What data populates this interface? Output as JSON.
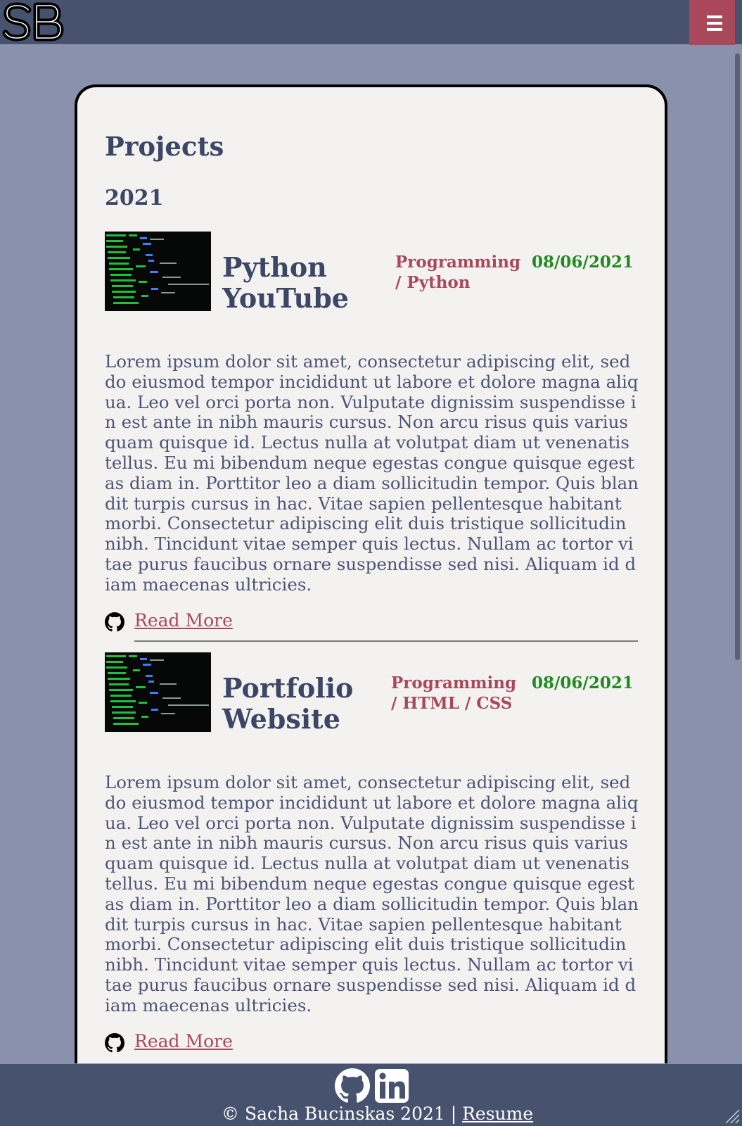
{
  "header": {
    "logo_text": "SB",
    "menu_icon": "hamburger-menu-icon"
  },
  "main": {
    "title": "Projects",
    "year": "2021",
    "projects": [
      {
        "title_line1": "Python",
        "title_line2": "YouTube",
        "category_line1": "Programming",
        "category_line2": "/ Python",
        "date": "08/06/2021",
        "description": "Lorem ipsum dolor sit amet, consectetur adipiscing elit, sed do eiusmod tempor incididunt ut labore et dolore magna aliqua. Leo vel orci porta non. Vulputate dignissim suspendisse in est ante in nibh mauris cursus. Non arcu risus quis varius quam quisque id. Lectus nulla at volutpat diam ut venenatis tellus. Eu mi bibendum neque egestas congue quisque egestas diam in. Porttitor leo a diam sollicitudin tempor. Quis blandit turpis cursus in hac. Vitae sapien pellentesque habitant morbi. Consectetur adipiscing elit duis tristique sollicitudin nibh. Tincidunt vitae semper quis lectus. Nullam ac tortor vitae purus faucibus ornare suspendisse sed nisi. Aliquam id diam maecenas ultricies.",
        "read_more": "Read More",
        "link_icon": "github-icon"
      },
      {
        "title_line1": "Portfolio",
        "title_line2": "Website",
        "category_line1": "Programming",
        "category_line2": "/ HTML / CSS",
        "date": "08/06/2021",
        "description": "Lorem ipsum dolor sit amet, consectetur adipiscing elit, sed do eiusmod tempor incididunt ut labore et dolore magna aliqua. Leo vel orci porta non. Vulputate dignissim suspendisse in est ante in nibh mauris cursus. Non arcu risus quis varius quam quisque id. Lectus nulla at volutpat diam ut venenatis tellus. Eu mi bibendum neque egestas congue quisque egestas diam in. Porttitor leo a diam sollicitudin tempor. Quis blandit turpis cursus in hac. Vitae sapien pellentesque habitant morbi. Consectetur adipiscing elit duis tristique sollicitudin nibh. Tincidunt vitae semper quis lectus. Nullam ac tortor vitae purus faucibus ornare suspendisse sed nisi. Aliquam id diam maecenas ultricies.",
        "read_more": "Read More",
        "link_icon": "github-icon"
      }
    ]
  },
  "footer": {
    "icons": [
      "github-icon",
      "linkedin-icon"
    ],
    "copyright": "© Sacha Bucinskas 2021 |",
    "resume_link": "Resume"
  },
  "colors": {
    "header_bg": "#47536e",
    "page_bg": "#8a91ac",
    "card_bg": "#f4f2f1",
    "accent": "#a8485a",
    "date_green": "#1f8a1f",
    "heading": "#3c4766"
  }
}
